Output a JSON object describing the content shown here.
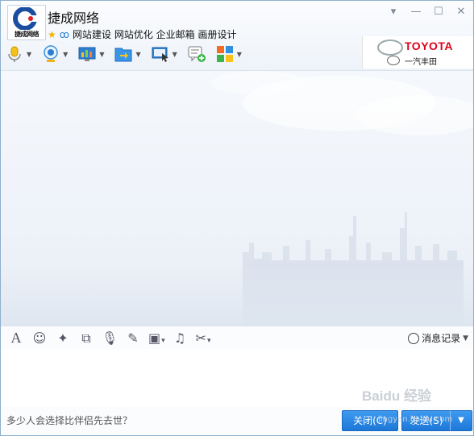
{
  "contact": {
    "name": "捷成网络",
    "avatar_caption": "捷成网络",
    "signature": "网站建设 网站优化 企业邮箱 画册设计"
  },
  "ad": {
    "brand": "TOYOTA",
    "sub": "一汽丰田"
  },
  "toolbar": {
    "items": [
      {
        "icon": "microphone-icon"
      },
      {
        "icon": "webcam-icon"
      },
      {
        "icon": "screen-share-icon"
      },
      {
        "icon": "send-file-icon"
      },
      {
        "icon": "remote-desktop-icon"
      },
      {
        "icon": "create-discussion-icon"
      },
      {
        "icon": "apps-icon"
      }
    ]
  },
  "input_toolbar": {
    "history_label": "消息记录"
  },
  "footer": {
    "tip": "多少人会选择比伴侣先去世？",
    "close_label": "关闭(C)",
    "send_label": "发送(S)",
    "menu_glyph": "▼"
  },
  "watermark": {
    "text": "Baidu 经验",
    "sub": "jingyan.baidu.com"
  },
  "colors": {
    "accent": "#1d77d8",
    "border": "#8fb0cc"
  }
}
